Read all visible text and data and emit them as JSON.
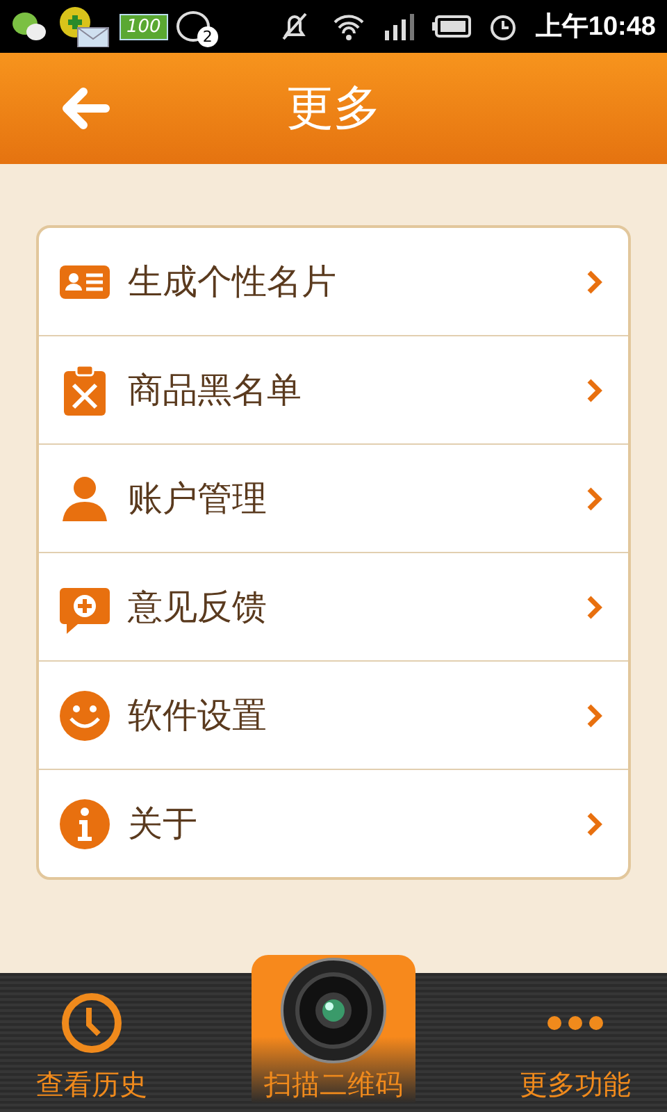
{
  "status_bar": {
    "battery_badge": "100",
    "chat_count": "2",
    "time": "上午10:48"
  },
  "header": {
    "title": "更多"
  },
  "menu": [
    {
      "label": "生成个性名片",
      "kind": "card"
    },
    {
      "label": "商品黑名单",
      "kind": "clipboard"
    },
    {
      "label": "账户管理",
      "kind": "person"
    },
    {
      "label": "意见反馈",
      "kind": "feedback"
    },
    {
      "label": "软件设置",
      "kind": "smiley"
    },
    {
      "label": "关于",
      "kind": "info"
    }
  ],
  "tab_bar": [
    {
      "label": "查看历史",
      "kind": "clock"
    },
    {
      "label": "扫描二维码",
      "kind": "camera"
    },
    {
      "label": "更多功能",
      "kind": "dots"
    }
  ]
}
